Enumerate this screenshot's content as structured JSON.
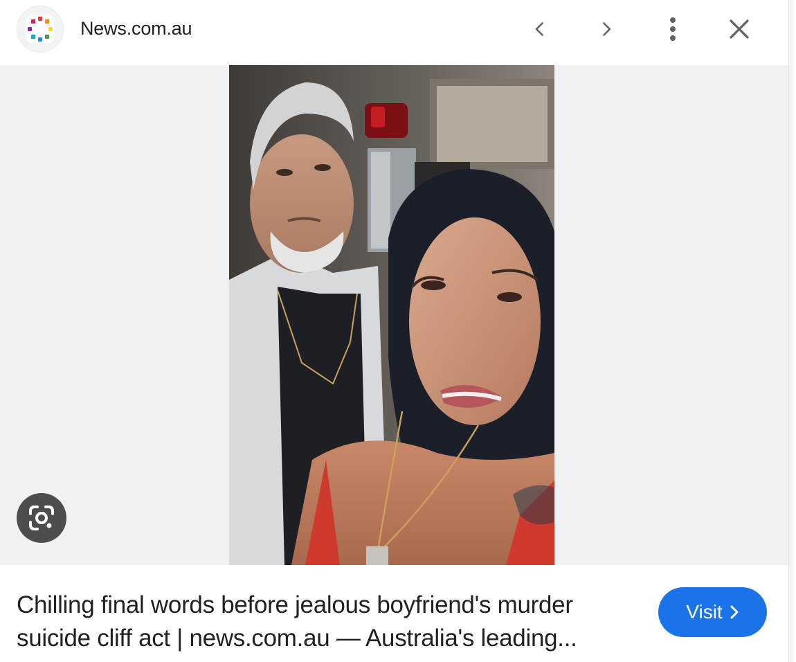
{
  "header": {
    "site_name": "News.com.au",
    "favicon_icon": "news-multicolor-dots-icon",
    "buttons": {
      "previous_icon": "chevron-left-icon",
      "next_icon": "chevron-right-icon",
      "more_icon": "more-vert-icon",
      "close_icon": "close-icon"
    }
  },
  "image": {
    "icon": "photo-icon",
    "lens_icon": "google-lens-icon"
  },
  "footer": {
    "caption": "Chilling final words before jealous boyfriend's murder suicide cliff act | news.com.au — Australia's leading...",
    "visit_label": "Visit",
    "visit_icon": "chevron-right-icon"
  },
  "colors": {
    "accent": "#1a73e8",
    "text": "#202124",
    "icon": "#5f6368",
    "stage_bg": "#f0f1f3"
  }
}
